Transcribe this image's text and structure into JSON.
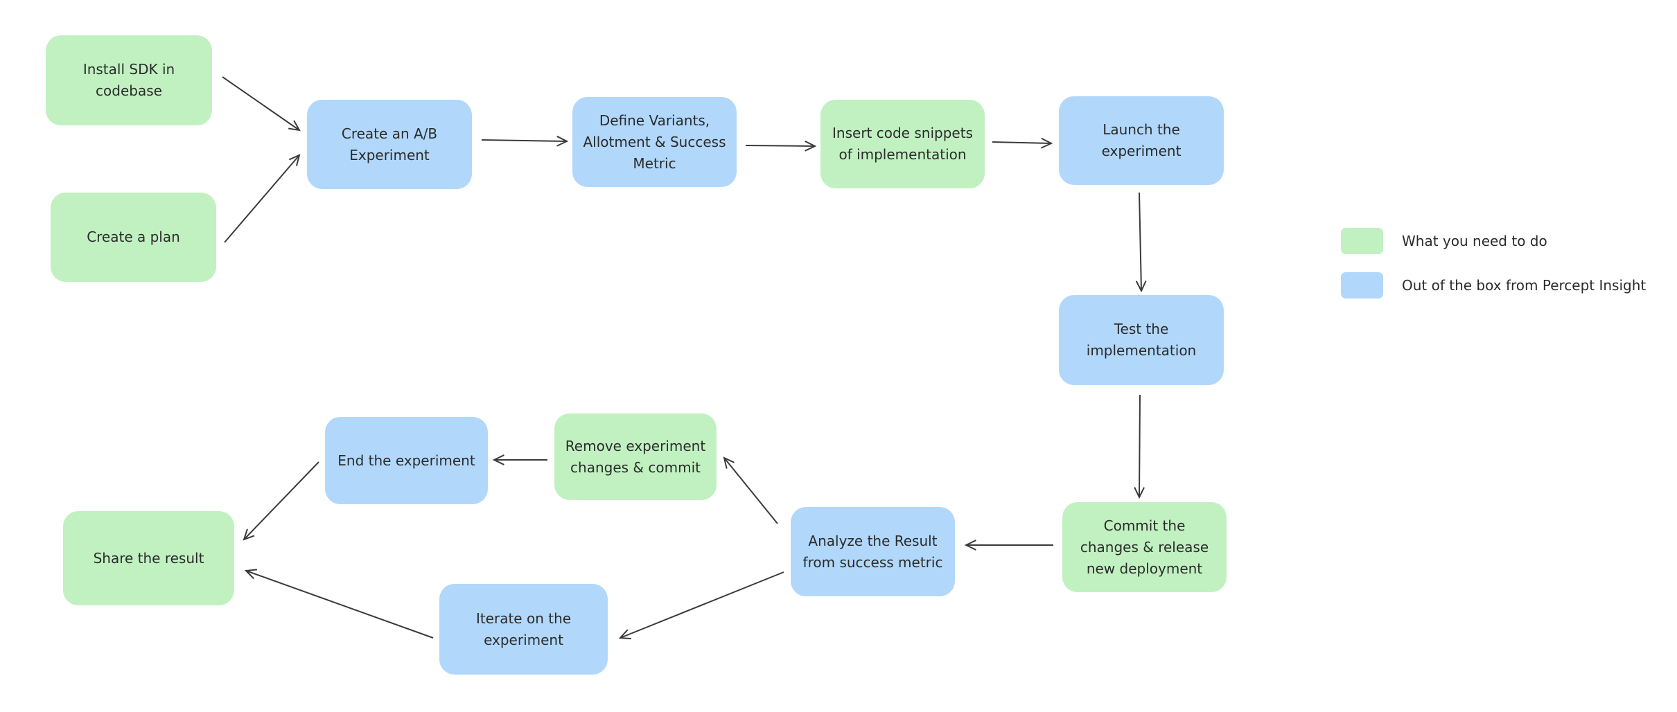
{
  "colors": {
    "user_task": "#c1f1c1",
    "percept_task": "#b1d8fb",
    "arrow": "#3a3a3a"
  },
  "nodes": {
    "install_sdk": "Install SDK in codebase",
    "create_plan": "Create a plan",
    "create_ab": "Create an A/B Experiment",
    "define_variants": "Define Variants, Allotment & Success Metric",
    "insert_code": "Insert code snippets of implementation",
    "launch": "Launch the experiment",
    "test": "Test the implementation",
    "commit": "Commit the changes & release new deployment",
    "analyze": "Analyze the Result from success metric",
    "remove": "Remove experiment changes & commit",
    "end": "End the experiment",
    "share": "Share the result",
    "iterate": "Iterate on the experiment"
  },
  "edges": [
    [
      "install_sdk",
      "create_ab"
    ],
    [
      "create_plan",
      "create_ab"
    ],
    [
      "create_ab",
      "define_variants"
    ],
    [
      "define_variants",
      "insert_code"
    ],
    [
      "insert_code",
      "launch"
    ],
    [
      "launch",
      "test"
    ],
    [
      "test",
      "commit"
    ],
    [
      "commit",
      "analyze"
    ],
    [
      "analyze",
      "remove"
    ],
    [
      "remove",
      "end"
    ],
    [
      "end",
      "share"
    ],
    [
      "analyze",
      "iterate"
    ],
    [
      "iterate",
      "share"
    ]
  ],
  "legend": {
    "user_task": "What you need to do",
    "percept_task": "Out of the box from Percept Insight"
  }
}
